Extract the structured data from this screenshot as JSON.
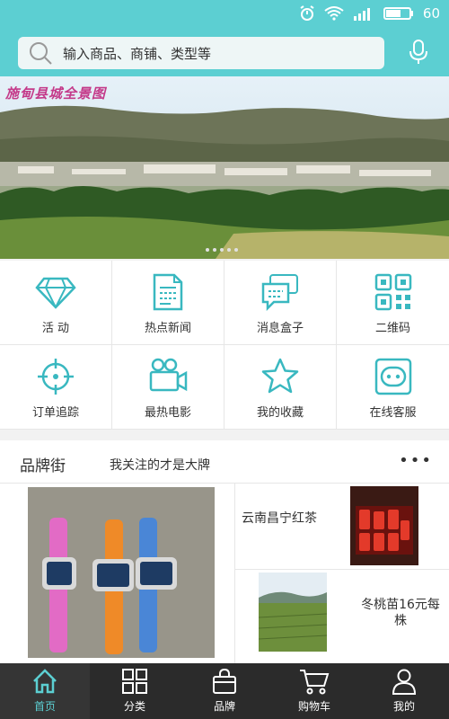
{
  "status_bar": {
    "battery": "60",
    "icons": [
      "alarm-icon",
      "wifi-icon",
      "signal-icon",
      "battery-icon"
    ]
  },
  "search": {
    "placeholder": "输入商品、商铺、类型等",
    "icon": "search-icon",
    "voice_icon": "microphone-icon"
  },
  "banner": {
    "title": "施甸县城全景图"
  },
  "menu": [
    {
      "label": "活 动",
      "icon": "diamond-icon"
    },
    {
      "label": "热点新闻",
      "icon": "document-icon"
    },
    {
      "label": "消息盒子",
      "icon": "chat-icon"
    },
    {
      "label": "二维码",
      "icon": "qrcode-icon"
    },
    {
      "label": "订单追踪",
      "icon": "target-icon"
    },
    {
      "label": "最热电影",
      "icon": "video-camera-icon"
    },
    {
      "label": "我的收藏",
      "icon": "star-icon"
    },
    {
      "label": "在线客服",
      "icon": "customer-service-icon"
    }
  ],
  "brand_street": {
    "title": "品牌街",
    "subtitle": "我关注的才是大牌",
    "more": "•••",
    "products": [
      {
        "title": "云南昌宁红茶"
      },
      {
        "title": "冬桃苗16元每株"
      }
    ]
  },
  "tabs": [
    {
      "label": "首页",
      "icon": "home-icon",
      "active": true
    },
    {
      "label": "分类",
      "icon": "grid-icon",
      "active": false
    },
    {
      "label": "品牌",
      "icon": "shopping-bag-icon",
      "active": false
    },
    {
      "label": "购物车",
      "icon": "cart-icon",
      "active": false
    },
    {
      "label": "我的",
      "icon": "user-icon",
      "active": false
    }
  ],
  "colors": {
    "accent": "#5ccfd2",
    "tabbar": "#2b2b2b"
  }
}
